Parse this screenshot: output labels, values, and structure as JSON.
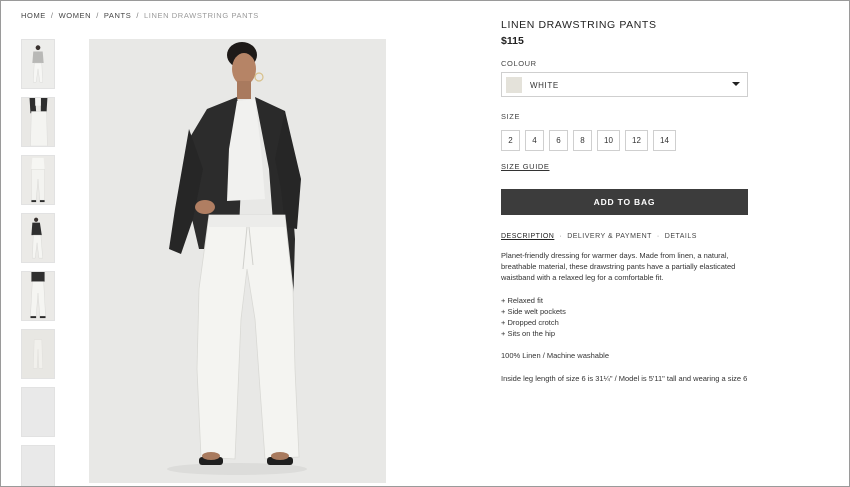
{
  "breadcrumb": {
    "items": [
      "HOME",
      "WOMEN",
      "PANTS"
    ],
    "separator": "/",
    "current": "LINEN DRAWSTRING PANTS"
  },
  "product": {
    "title": "LINEN DRAWSTRING PANTS",
    "price": "$115"
  },
  "colour": {
    "label": "COLOUR",
    "value": "WHITE",
    "swatch_color": "#e4e2da",
    "icon": "chevron-down-icon"
  },
  "size": {
    "label": "SIZE",
    "options": [
      "2",
      "4",
      "6",
      "8",
      "10",
      "12",
      "14"
    ],
    "guide_label": "SIZE GUIDE"
  },
  "cart": {
    "add_label": "ADD TO BAG",
    "button_color": "#3c3c3c"
  },
  "tabs": {
    "description": "DESCRIPTION",
    "delivery": "DELIVERY & PAYMENT",
    "details": "DETAILS",
    "separator": "·"
  },
  "description": {
    "intro": "Planet-friendly dressing for warmer days. Made from linen, a natural, breathable material, these drawstring pants have a partially elasticated waistband with a relaxed leg for a comfortable fit.",
    "bullets": [
      "+ Relaxed fit",
      "+ Side welt pockets",
      "+ Dropped crotch",
      "+ Sits on the hip"
    ],
    "composition": "100% Linen / Machine washable",
    "fit_note": "Inside leg length of size 6 is 31¼\" / Model is 5'11\" tall and wearing a size 6"
  }
}
